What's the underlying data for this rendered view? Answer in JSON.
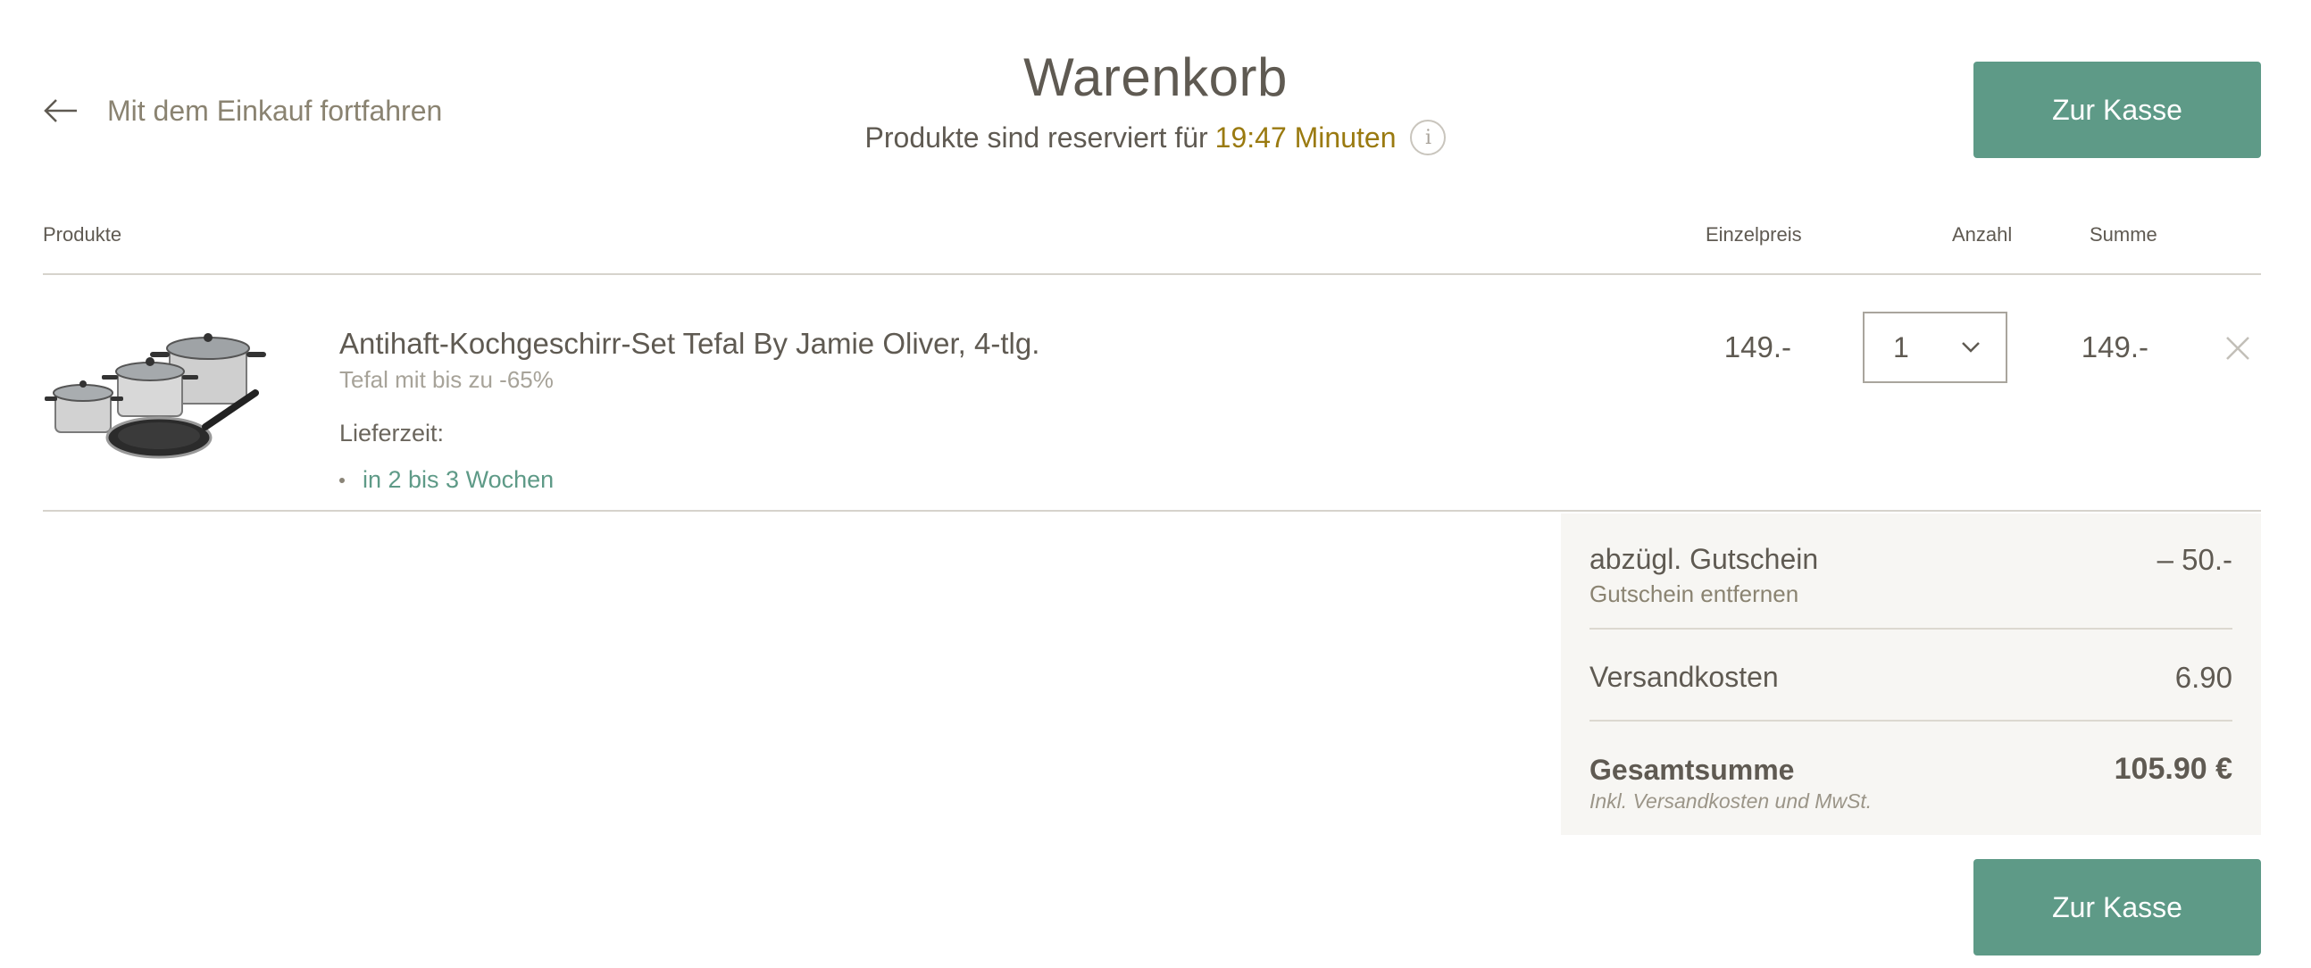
{
  "header": {
    "back_label": "Mit dem Einkauf fortfahren",
    "title": "Warenkorb",
    "reserved_prefix": "Produkte sind reserviert für",
    "reserved_timer": "19:47 Minuten",
    "info_glyph": "i",
    "checkout_label": "Zur Kasse"
  },
  "table": {
    "col_products": "Produkte",
    "col_unit_price": "Einzelpreis",
    "col_quantity": "Anzahl",
    "col_total": "Summe"
  },
  "item": {
    "name": "Antihaft-Kochgeschirr-Set Tefal By Jamie Oliver, 4-tlg.",
    "subtitle": "Tefal mit bis zu -65%",
    "delivery_label": "Lieferzeit:",
    "delivery_value": "in 2 bis 3 Wochen",
    "unit_price": "149.-",
    "quantity": "1",
    "line_total": "149.-",
    "image_icon": "cookware-set-image",
    "remove_icon": "close-icon"
  },
  "summary": {
    "voucher_label": "abzügl. Gutschein",
    "voucher_remove": "Gutschein entfernen",
    "voucher_value": "– 50.-",
    "shipping_label": "Versandkosten",
    "shipping_value": "6.90",
    "total_label": "Gesamtsumme",
    "total_note": "Inkl. Versandkosten und MwSt.",
    "total_value": "105.90 €"
  },
  "footer": {
    "checkout_label": "Zur Kasse"
  },
  "colors": {
    "accent_green": "#5e9a87",
    "timer_gold": "#9a7a10",
    "summary_bg": "#f7f6f3"
  }
}
